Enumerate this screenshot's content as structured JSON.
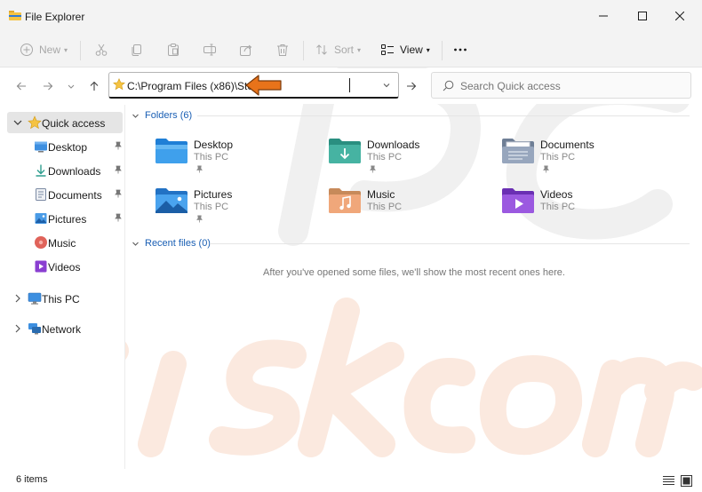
{
  "window": {
    "title": "File Explorer",
    "minimize_label": "Minimize",
    "maximize_label": "Maximize",
    "close_label": "Close"
  },
  "toolbar": {
    "new_label": "New",
    "sort_label": "Sort",
    "view_label": "View"
  },
  "address": {
    "path": "C:\\Program Files (x86)\\Steam"
  },
  "search": {
    "placeholder": "Search Quick access"
  },
  "sidebar": {
    "quick_access": "Quick access",
    "items": [
      {
        "label": "Desktop",
        "pinned": true
      },
      {
        "label": "Downloads",
        "pinned": true
      },
      {
        "label": "Documents",
        "pinned": true
      },
      {
        "label": "Pictures",
        "pinned": true
      },
      {
        "label": "Music",
        "pinned": false
      },
      {
        "label": "Videos",
        "pinned": false
      }
    ],
    "this_pc": "This PC",
    "network": "Network"
  },
  "main": {
    "folders_header": "Folders (6)",
    "folders": [
      {
        "name": "Desktop",
        "location": "This PC",
        "pinned": true
      },
      {
        "name": "Downloads",
        "location": "This PC",
        "pinned": true
      },
      {
        "name": "Documents",
        "location": "This PC",
        "pinned": true
      },
      {
        "name": "Pictures",
        "location": "This PC",
        "pinned": true
      },
      {
        "name": "Music",
        "location": "This PC",
        "pinned": false
      },
      {
        "name": "Videos",
        "location": "This PC",
        "pinned": false
      }
    ],
    "recent_header": "Recent files (0)",
    "recent_empty": "After you've opened some files, we'll show the most recent ones here."
  },
  "status": {
    "item_count": "6 items"
  },
  "colors": {
    "accent": "#1a5fb4",
    "annotation_arrow": "#e8731a",
    "folder_yellow": "#f5c342",
    "titlebar_bg": "#f3f3f3"
  }
}
